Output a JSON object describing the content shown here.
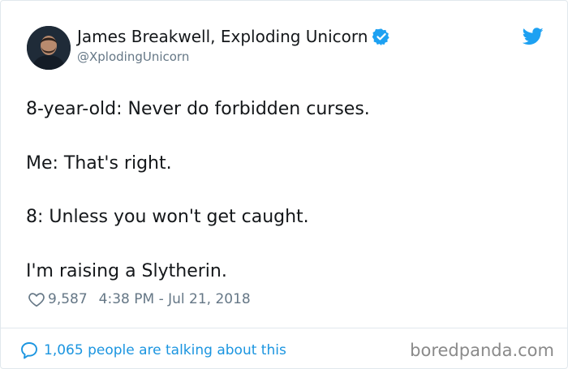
{
  "author": {
    "display_name": "James Breakwell, Exploding Unicorn",
    "handle": "@XplodingUnicorn",
    "verified": true
  },
  "tweet": {
    "lines": [
      "8-year-old: Never do forbidden curses.",
      "Me: That's right.",
      "8: Unless you won't get caught.",
      "I'm raising a Slytherin."
    ],
    "likes": "9,587",
    "timestamp": "4:38 PM - Jul 21, 2018"
  },
  "footer": {
    "conversation_text": "1,065 people are talking about this"
  },
  "watermark": "boredpanda.com",
  "colors": {
    "text": "#14171a",
    "secondary": "#657786",
    "twitter_blue": "#1da1f2",
    "link_blue": "#1b95e0",
    "border": "#e1e8ed"
  },
  "icons": [
    "avatar",
    "verified-badge-icon",
    "twitter-bird-icon",
    "heart-icon",
    "speech-bubble-icon"
  ]
}
